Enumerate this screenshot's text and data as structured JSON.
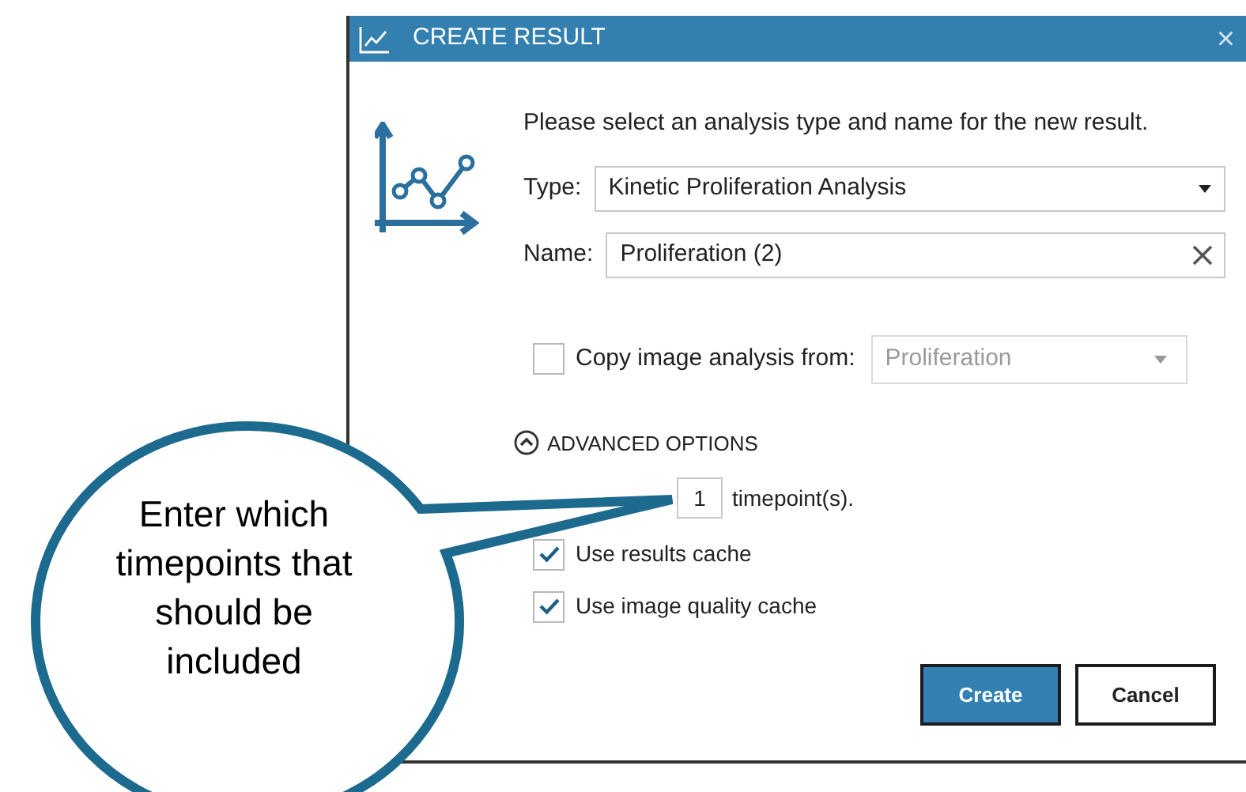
{
  "window": {
    "title": "CREATE RESULT",
    "close": "×"
  },
  "intro": "Please select an analysis type and name for the new result.",
  "type_field": {
    "label": "Type:",
    "value": "Kinetic Proliferation Analysis"
  },
  "name_field": {
    "label": "Name:",
    "value": "Proliferation (2)"
  },
  "copy_analysis": {
    "label": "Copy image analysis from:",
    "checked": false,
    "value": "Proliferation",
    "disabled": true
  },
  "advanced": {
    "label": "ADVANCED OPTIONS",
    "expanded": true
  },
  "include": {
    "value": "1",
    "suffix": "timepoint(s)."
  },
  "options": [
    {
      "label": "Use results cache",
      "checked": true
    },
    {
      "label": "Use image quality cache",
      "checked": true
    }
  ],
  "buttons": [
    {
      "label": "Create",
      "kind": "primary"
    },
    {
      "label": "Cancel",
      "kind": "secondary"
    }
  ],
  "callout": {
    "text": "Enter which timepoints that should be included"
  }
}
